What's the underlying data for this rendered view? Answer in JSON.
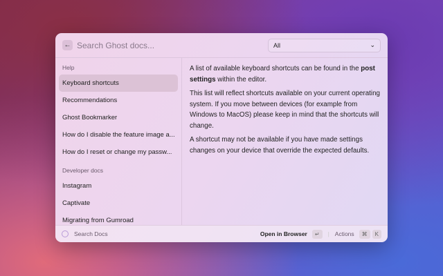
{
  "header": {
    "back_icon": "arrow-left-icon",
    "search_placeholder": "Search Ghost docs...",
    "filter": "All"
  },
  "sidebar": {
    "sections": [
      {
        "title": "Help",
        "items": [
          "Keyboard shortcuts",
          "Recommendations",
          "Ghost Bookmarker",
          "How do I disable the feature image a...",
          "How do I reset or change my passw..."
        ]
      },
      {
        "title": "Developer docs",
        "items": [
          "Instagram",
          "Captivate",
          "Migrating from Gumroad"
        ]
      }
    ]
  },
  "content": {
    "p1_pre": "A list of available keyboard shortcuts can be found in the ",
    "p1_bold": "post settings",
    "p1_post": " within the editor.",
    "p2": "This list will reflect shortcuts available on your current operating system. If you move between devices (for example from Windows to MacOS) please keep in mind that the shortcuts will change.",
    "p3": "A shortcut may not be available if you have made settings changes on your device that override the expected defaults."
  },
  "footer": {
    "label": "Search Docs",
    "open": "Open in Browser",
    "enter_key": "↵",
    "actions": "Actions",
    "cmd_key": "⌘",
    "k_key": "K"
  }
}
